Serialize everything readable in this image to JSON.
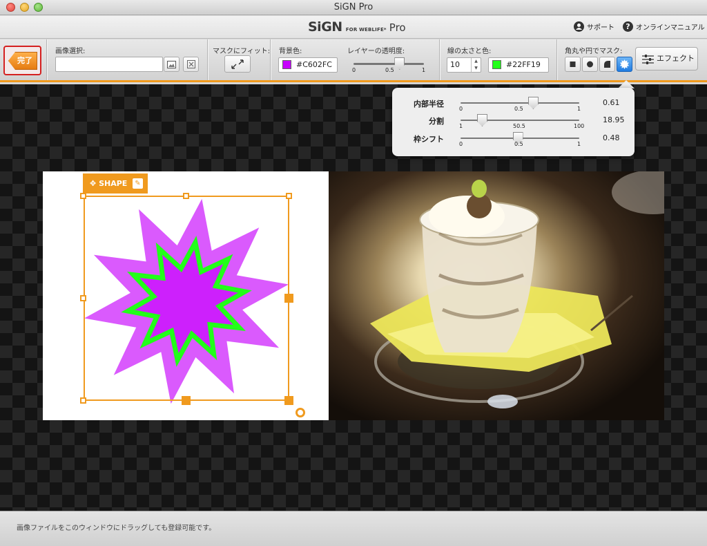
{
  "window": {
    "title": "SiGN Pro"
  },
  "header": {
    "logo_main": "SiGN",
    "logo_for": "FOR WEBLIFE*",
    "logo_pro": "Pro",
    "support": "サポート",
    "manual": "オンラインマニュアル",
    "support_icon": "person-icon",
    "manual_icon": "help-icon"
  },
  "toolbar": {
    "done_label": "完了",
    "image_select_label": "画像選択:",
    "image_select_value": "",
    "fit_mask_label": "マスクにフィット:",
    "bg_color_label": "背景色:",
    "bg_color_value": "#C602FC",
    "bg_color": "#C602FC",
    "opacity_label": "レイヤーの透明度:",
    "opacity_min": "0",
    "opacity_mid": "0.5",
    "opacity_max": "1",
    "opacity_value": 0.65,
    "stroke_label": "線の太さと色:",
    "stroke_width": "10",
    "stroke_color_value": "#22FF19",
    "stroke_color": "#22FF19",
    "mask_label": "角丸や円でマスク:",
    "mask_shapes": [
      "square",
      "circle",
      "rounded-corner",
      "star"
    ],
    "mask_selected": "star",
    "effect_label": "エフェクト",
    "accent_color": "#F09A1E"
  },
  "popover": {
    "rows": [
      {
        "label": "内部半径",
        "min": "0",
        "mid": "0.5",
        "max": "1",
        "value": "0.61",
        "fraction": 0.61
      },
      {
        "label": "分割",
        "min": "1",
        "mid": "50.5",
        "max": "100",
        "value": "18.95",
        "fraction": 0.18
      },
      {
        "label": "枠シフト",
        "min": "0",
        "mid": "0.5",
        "max": "1",
        "value": "0.48",
        "fraction": 0.48
      }
    ]
  },
  "canvas": {
    "shape_tag": "SHAPE",
    "shape_fill": "#C602FC",
    "shape_stroke": "#22FF19",
    "selection_color": "#F09A1E"
  },
  "status": {
    "text": "画像ファイルをこのウィンドウにドラッグしても登録可能です。"
  }
}
